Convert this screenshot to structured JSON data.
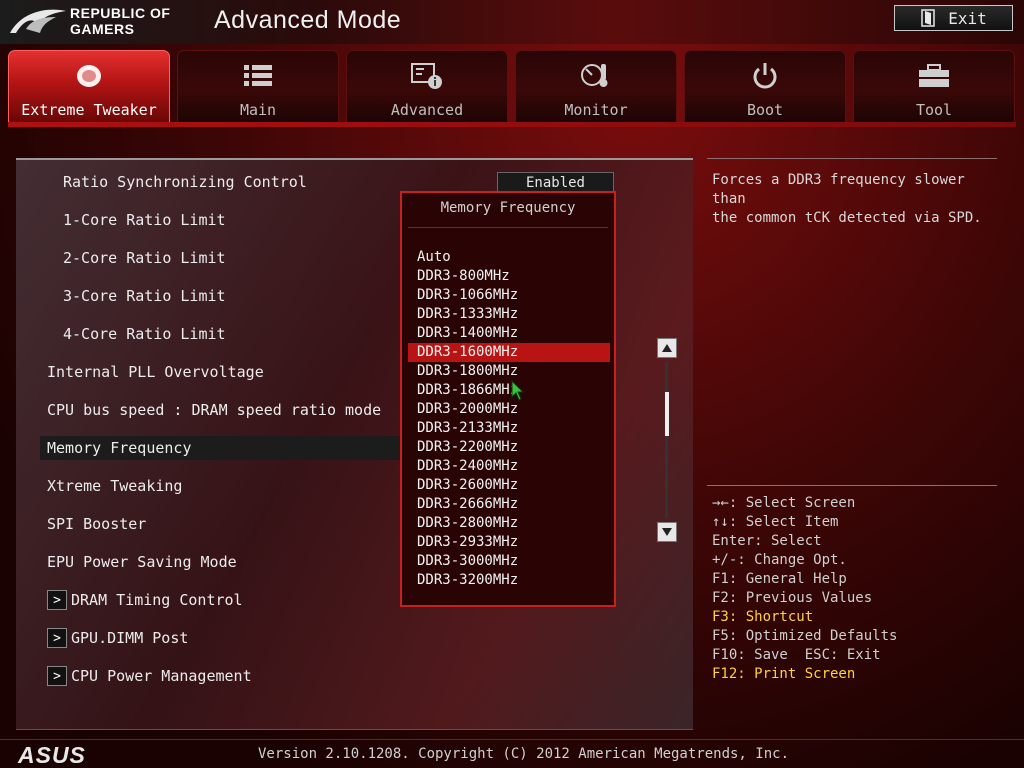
{
  "header": {
    "brand_line1": "REPUBLIC OF",
    "brand_line2": "GAMERS",
    "mode_title": "Advanced Mode",
    "exit_label": "Exit"
  },
  "tabs": [
    {
      "label": "Extreme Tweaker",
      "icon": "tweaker-icon",
      "active": true
    },
    {
      "label": "Main",
      "icon": "list-icon",
      "active": false
    },
    {
      "label": "Advanced",
      "icon": "advanced-info-icon",
      "active": false
    },
    {
      "label": "Monitor",
      "icon": "thermometer-gauge-icon",
      "active": false
    },
    {
      "label": "Boot",
      "icon": "power-icon",
      "active": false
    },
    {
      "label": "Tool",
      "icon": "toolbox-icon",
      "active": false
    }
  ],
  "settings": {
    "ratio_sync": {
      "label": "Ratio Synchronizing Control",
      "value": "Enabled"
    },
    "core1": "1-Core Ratio Limit",
    "core2": "2-Core Ratio Limit",
    "core3": "3-Core Ratio Limit",
    "core4": "4-Core Ratio Limit",
    "pll": "Internal PLL Overvoltage",
    "cpu_bus": "CPU bus speed : DRAM speed ratio mode",
    "mem_freq": "Memory Frequency",
    "xtreme": "Xtreme Tweaking",
    "spi": "SPI Booster",
    "epu": "EPU Power Saving Mode",
    "dram_timing": "DRAM Timing Control",
    "gpu_dimm": "GPU.DIMM Post",
    "cpu_power": "CPU Power Management"
  },
  "popup": {
    "title": "Memory Frequency",
    "selected_index": 5,
    "options": [
      "Auto",
      "DDR3-800MHz",
      "DDR3-1066MHz",
      "DDR3-1333MHz",
      "DDR3-1400MHz",
      "DDR3-1600MHz",
      "DDR3-1800MHz",
      "DDR3-1866MHz",
      "DDR3-2000MHz",
      "DDR3-2133MHz",
      "DDR3-2200MHz",
      "DDR3-2400MHz",
      "DDR3-2600MHz",
      "DDR3-2666MHz",
      "DDR3-2800MHz",
      "DDR3-2933MHz",
      "DDR3-3000MHz",
      "DDR3-3200MHz"
    ]
  },
  "help": {
    "description": "Forces a DDR3 frequency slower than\nthe common tCK detected via SPD.",
    "keys": [
      {
        "text": "→←: Select Screen",
        "highlight": false
      },
      {
        "text": "↑↓: Select Item",
        "highlight": false
      },
      {
        "text": "Enter: Select",
        "highlight": false
      },
      {
        "text": "+/-: Change Opt.",
        "highlight": false
      },
      {
        "text": "F1: General Help",
        "highlight": false
      },
      {
        "text": "F2: Previous Values",
        "highlight": false
      },
      {
        "text": "F3: Shortcut",
        "highlight": true
      },
      {
        "text": "F5: Optimized Defaults",
        "highlight": false
      },
      {
        "text": "F10: Save  ESC: Exit",
        "highlight": false
      },
      {
        "text": "F12: Print Screen",
        "highlight": true
      }
    ]
  },
  "footer": {
    "brand": "ASUS",
    "version": "Version 2.10.1208. Copyright (C) 2012 American Megatrends, Inc."
  },
  "colors": {
    "accent_red": "#b81414",
    "highlight_yellow": "#ffd23c"
  }
}
